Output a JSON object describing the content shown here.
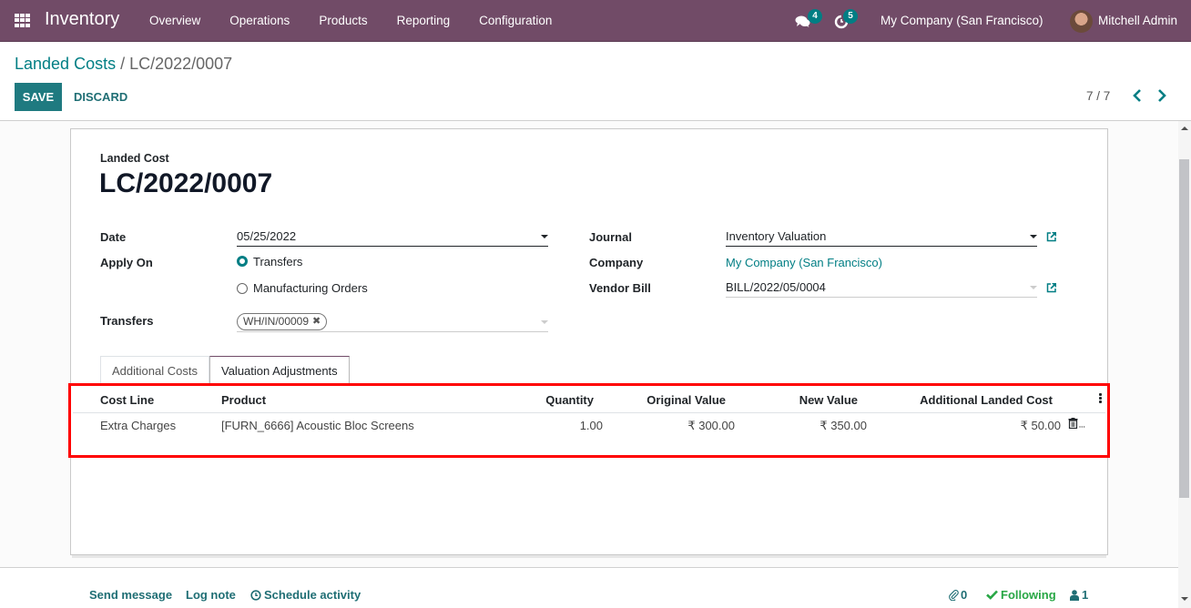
{
  "navbar": {
    "app_name": "Inventory",
    "menu": [
      "Overview",
      "Operations",
      "Products",
      "Reporting",
      "Configuration"
    ],
    "messages_count": "4",
    "activities_count": "5",
    "company": "My Company (San Francisco)",
    "user": "Mitchell Admin",
    "icons": {
      "apps": "grid-icon",
      "messages": "chat-bubbles-icon",
      "activities": "clock-icon"
    }
  },
  "control_panel": {
    "breadcrumb_parent": "Landed Costs",
    "breadcrumb_sep": " / ",
    "breadcrumb_current": "LC/2022/0007",
    "save_label": "SAVE",
    "discard_label": "DISCARD",
    "pager": "7 / 7",
    "prev_glyph": "❮",
    "next_glyph": "❯"
  },
  "form": {
    "record_type": "Landed Cost",
    "record_name": "LC/2022/0007",
    "left": {
      "date_label": "Date",
      "date_value": "05/25/2022",
      "apply_on_label": "Apply On",
      "apply_on_options": [
        "Transfers",
        "Manufacturing Orders"
      ],
      "apply_on_selected": "Transfers",
      "transfers_label": "Transfers",
      "transfers_tags": [
        "WH/IN/00009"
      ]
    },
    "right": {
      "journal_label": "Journal",
      "journal_value": "Inventory Valuation",
      "company_label": "Company",
      "company_value": "My Company (San Francisco)",
      "vendor_bill_label": "Vendor Bill",
      "vendor_bill_value": "BILL/2022/05/0004"
    },
    "tabs": [
      {
        "label": "Additional Costs",
        "active": false
      },
      {
        "label": "Valuation Adjustments",
        "active": true
      }
    ],
    "table": {
      "columns": [
        "Cost Line",
        "Product",
        "Quantity",
        "Original Value",
        "New Value",
        "Additional Landed Cost"
      ],
      "rows": [
        {
          "cost_line": "Extra Charges",
          "product": "[FURN_6666] Acoustic Bloc Screens",
          "quantity": "1.00",
          "original_value": "₹ 300.00",
          "new_value": "₹ 350.00",
          "additional_landed_cost": "₹ 50.00"
        }
      ]
    },
    "highlight_color": "#ff0000"
  },
  "chatter": {
    "send_message": "Send message",
    "log_note": "Log note",
    "schedule_activity": "Schedule activity",
    "attachments": "0",
    "following": "Following",
    "followers": "1"
  },
  "colors": {
    "brand": "#714b67",
    "accent": "#017e84",
    "primary_button": "#1f7a80",
    "following": "#28a745"
  }
}
